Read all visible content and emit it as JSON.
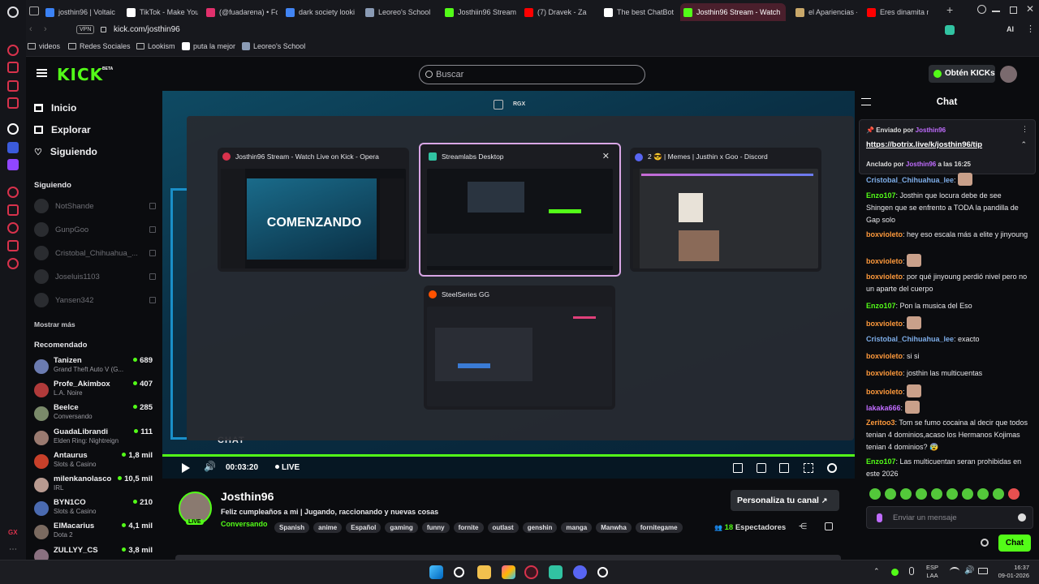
{
  "browser": {
    "tabs": [
      {
        "title": "josthin96 | Voltaic",
        "color": "#3b82f6",
        "active": false
      },
      {
        "title": "TikTok - Make You",
        "color": "#ffffff",
        "active": false
      },
      {
        "title": "(@fuadarena) • Fo",
        "color": "#e1306c",
        "active": false
      },
      {
        "title": "dark society looki",
        "color": "#4285f4",
        "active": false
      },
      {
        "title": "Leoreo's School",
        "color": "#8a9bb5",
        "active": false
      },
      {
        "title": "Josthiin96 Stream",
        "color": "#53fc18",
        "active": false
      },
      {
        "title": "(7) Dravek - Za",
        "color": "#ff0000",
        "active": false
      },
      {
        "title": "The best ChatBot",
        "color": "#ffffff",
        "active": false
      },
      {
        "title": "Josthin96 Stream - Watch",
        "color": "#53fc18",
        "active": true
      },
      {
        "title": "el Apariencias -",
        "color": "#c9a86a",
        "active": false
      },
      {
        "title": "Eres dinamita nen",
        "color": "#ff0000",
        "active": false
      }
    ],
    "vpn": "VPN",
    "url": "kick.com/josthin96",
    "bookmarks": [
      "videos",
      "Redes Sociales",
      "Lookism",
      "puta la mejor",
      "Leoreo's School"
    ],
    "ai_label": "AI"
  },
  "header": {
    "logo": "KICK",
    "logo_sup": "BETA",
    "search_placeholder": "Buscar",
    "kicks_button": "Obtén KICKs"
  },
  "nav": {
    "inicio": "Inicio",
    "explorar": "Explorar",
    "siguiendo": "Siguiendo",
    "following_title": "Siguiendo",
    "following": [
      "NotShande",
      "GunpGoo",
      "Cristobal_Chihuahua_...",
      "Joseluis1103",
      "Yansen342"
    ],
    "show_more": "Mostrar más",
    "recommended_title": "Recomendado",
    "recommended": [
      {
        "name": "Tanizen",
        "game": "Grand Theft Auto V (G...",
        "viewers": "689",
        "color": "#6b7bb0"
      },
      {
        "name": "Profe_Akimbox",
        "game": "L.A. Noire",
        "viewers": "407",
        "color": "#b03a3a"
      },
      {
        "name": "Beelce",
        "game": "Conversando",
        "viewers": "285",
        "color": "#7a8a6a"
      },
      {
        "name": "GuadaLibrandi",
        "game": "Elden Ring: Nightreign",
        "viewers": "111",
        "color": "#9a7a70"
      },
      {
        "name": "Antaurus",
        "game": "Slots & Casino",
        "viewers": "1,8 mil",
        "color": "#c8402a"
      },
      {
        "name": "milenkanolasco",
        "game": "IRL",
        "viewers": "10,5 mil",
        "color": "#b89a90"
      },
      {
        "name": "BYN1CO",
        "game": "Slots & Casino",
        "viewers": "210",
        "color": "#4a6ab0"
      },
      {
        "name": "ElMacarius",
        "game": "Dota 2",
        "viewers": "4,1 mil",
        "color": "#7a6a60"
      },
      {
        "name": "ZULLYY_CS",
        "game": "",
        "viewers": "3,8 mil",
        "color": "#8a7080"
      }
    ]
  },
  "switcher": {
    "top_label": "RGX",
    "windows": [
      {
        "title": "Josthin96 Stream - Watch Live on Kick - Opera",
        "color": "#d8324c",
        "thumb_text": "COMENZANDO"
      },
      {
        "title": "Streamlabs Desktop",
        "color": "#31c3a2",
        "thumb_text": ""
      },
      {
        "title": "2 😎 | Memes | Justhin x Goo - Discord",
        "color": "#5865f2",
        "thumb_text": ""
      },
      {
        "title": "SteelSeries GG",
        "color": "#ff5200",
        "thumb_text": ""
      }
    ],
    "close_glyph": "✕"
  },
  "player": {
    "overlay_text": "CHAT",
    "time": "00:03:20",
    "live": "LIVE"
  },
  "channel": {
    "name": "Josthin96",
    "live_badge": "LIVE",
    "title": "Feliz cumpleaños a mi | Jugando, raccionando y nuevas cosas",
    "category": "Conversando",
    "tags": [
      "Spanish",
      "anime",
      "Español",
      "gaming",
      "funny",
      "fornite",
      "outlast",
      "genshin",
      "manga",
      "Manwha",
      "fornitegame"
    ],
    "customize_button": "Personaliza tu canal",
    "viewers_count": "18",
    "viewers_label": "Espectadores"
  },
  "chat": {
    "title": "Chat",
    "pinned_by_label": "Enviado por",
    "pinned_user": "Josthin96",
    "pinned_link": "https://botrix.live/k/josthin96/tip",
    "anchored_prefix": "Anclado por",
    "anchored_user": "Josthin96",
    "anchored_time": "a las 16:25",
    "messages": [
      {
        "user": "Cristobal_Chihuahua_lee",
        "color": "#7dade8",
        "text": "",
        "emote": true
      },
      {
        "user": "Enzo107",
        "color": "#53fc18",
        "text": "Josthin que locura debe de see Shingen que se enfrento a TODA la pandilla de Gap solo",
        "emote": false
      },
      {
        "user": "boxvioleto",
        "color": "#ff9a3c",
        "text": "hey eso escala más a elite y jinyoung",
        "emote": false
      },
      {
        "user": "boxvioleto",
        "color": "#ff9a3c",
        "text": "",
        "emote": true
      },
      {
        "user": "boxvioleto",
        "color": "#ff9a3c",
        "text": "por qué jinyoung perdió nivel pero no un aparte del cuerpo",
        "emote": false
      },
      {
        "user": "Enzo107",
        "color": "#53fc18",
        "text": "Pon la musica del Eso",
        "emote": false
      },
      {
        "user": "boxvioleto",
        "color": "#ff9a3c",
        "text": "",
        "emote": true
      },
      {
        "user": "Cristobal_Chihuahua_lee",
        "color": "#7dade8",
        "text": "exacto",
        "emote": false
      },
      {
        "user": "boxvioleto",
        "color": "#ff9a3c",
        "text": "si si",
        "emote": false
      },
      {
        "user": "boxvioleto",
        "color": "#ff9a3c",
        "text": "josthin las multicuentas",
        "emote": false
      },
      {
        "user": "boxvioleto",
        "color": "#ff9a3c",
        "text": "",
        "emote": true
      },
      {
        "user": "lakaka666",
        "color": "#c06cff",
        "text": "",
        "emote": true
      },
      {
        "user": "Zeritoo3",
        "color": "#ff9a3c",
        "text": "Tom se fumo cocaina al decir que todos tenian 4 dominios,acaso los Hermanos Kojimas tenian 4 dominios? 😰",
        "emote": false
      },
      {
        "user": "Enzo107",
        "color": "#53fc18",
        "text": "Las multicuentan seran prohibidas en este 2026",
        "emote": false
      }
    ],
    "input_placeholder": "Enviar un mensaje",
    "send_button": "Chat"
  },
  "taskbar": {
    "lang": "ESP",
    "lang2": "LAA",
    "time": "16:37",
    "date": "09-01-2026"
  }
}
